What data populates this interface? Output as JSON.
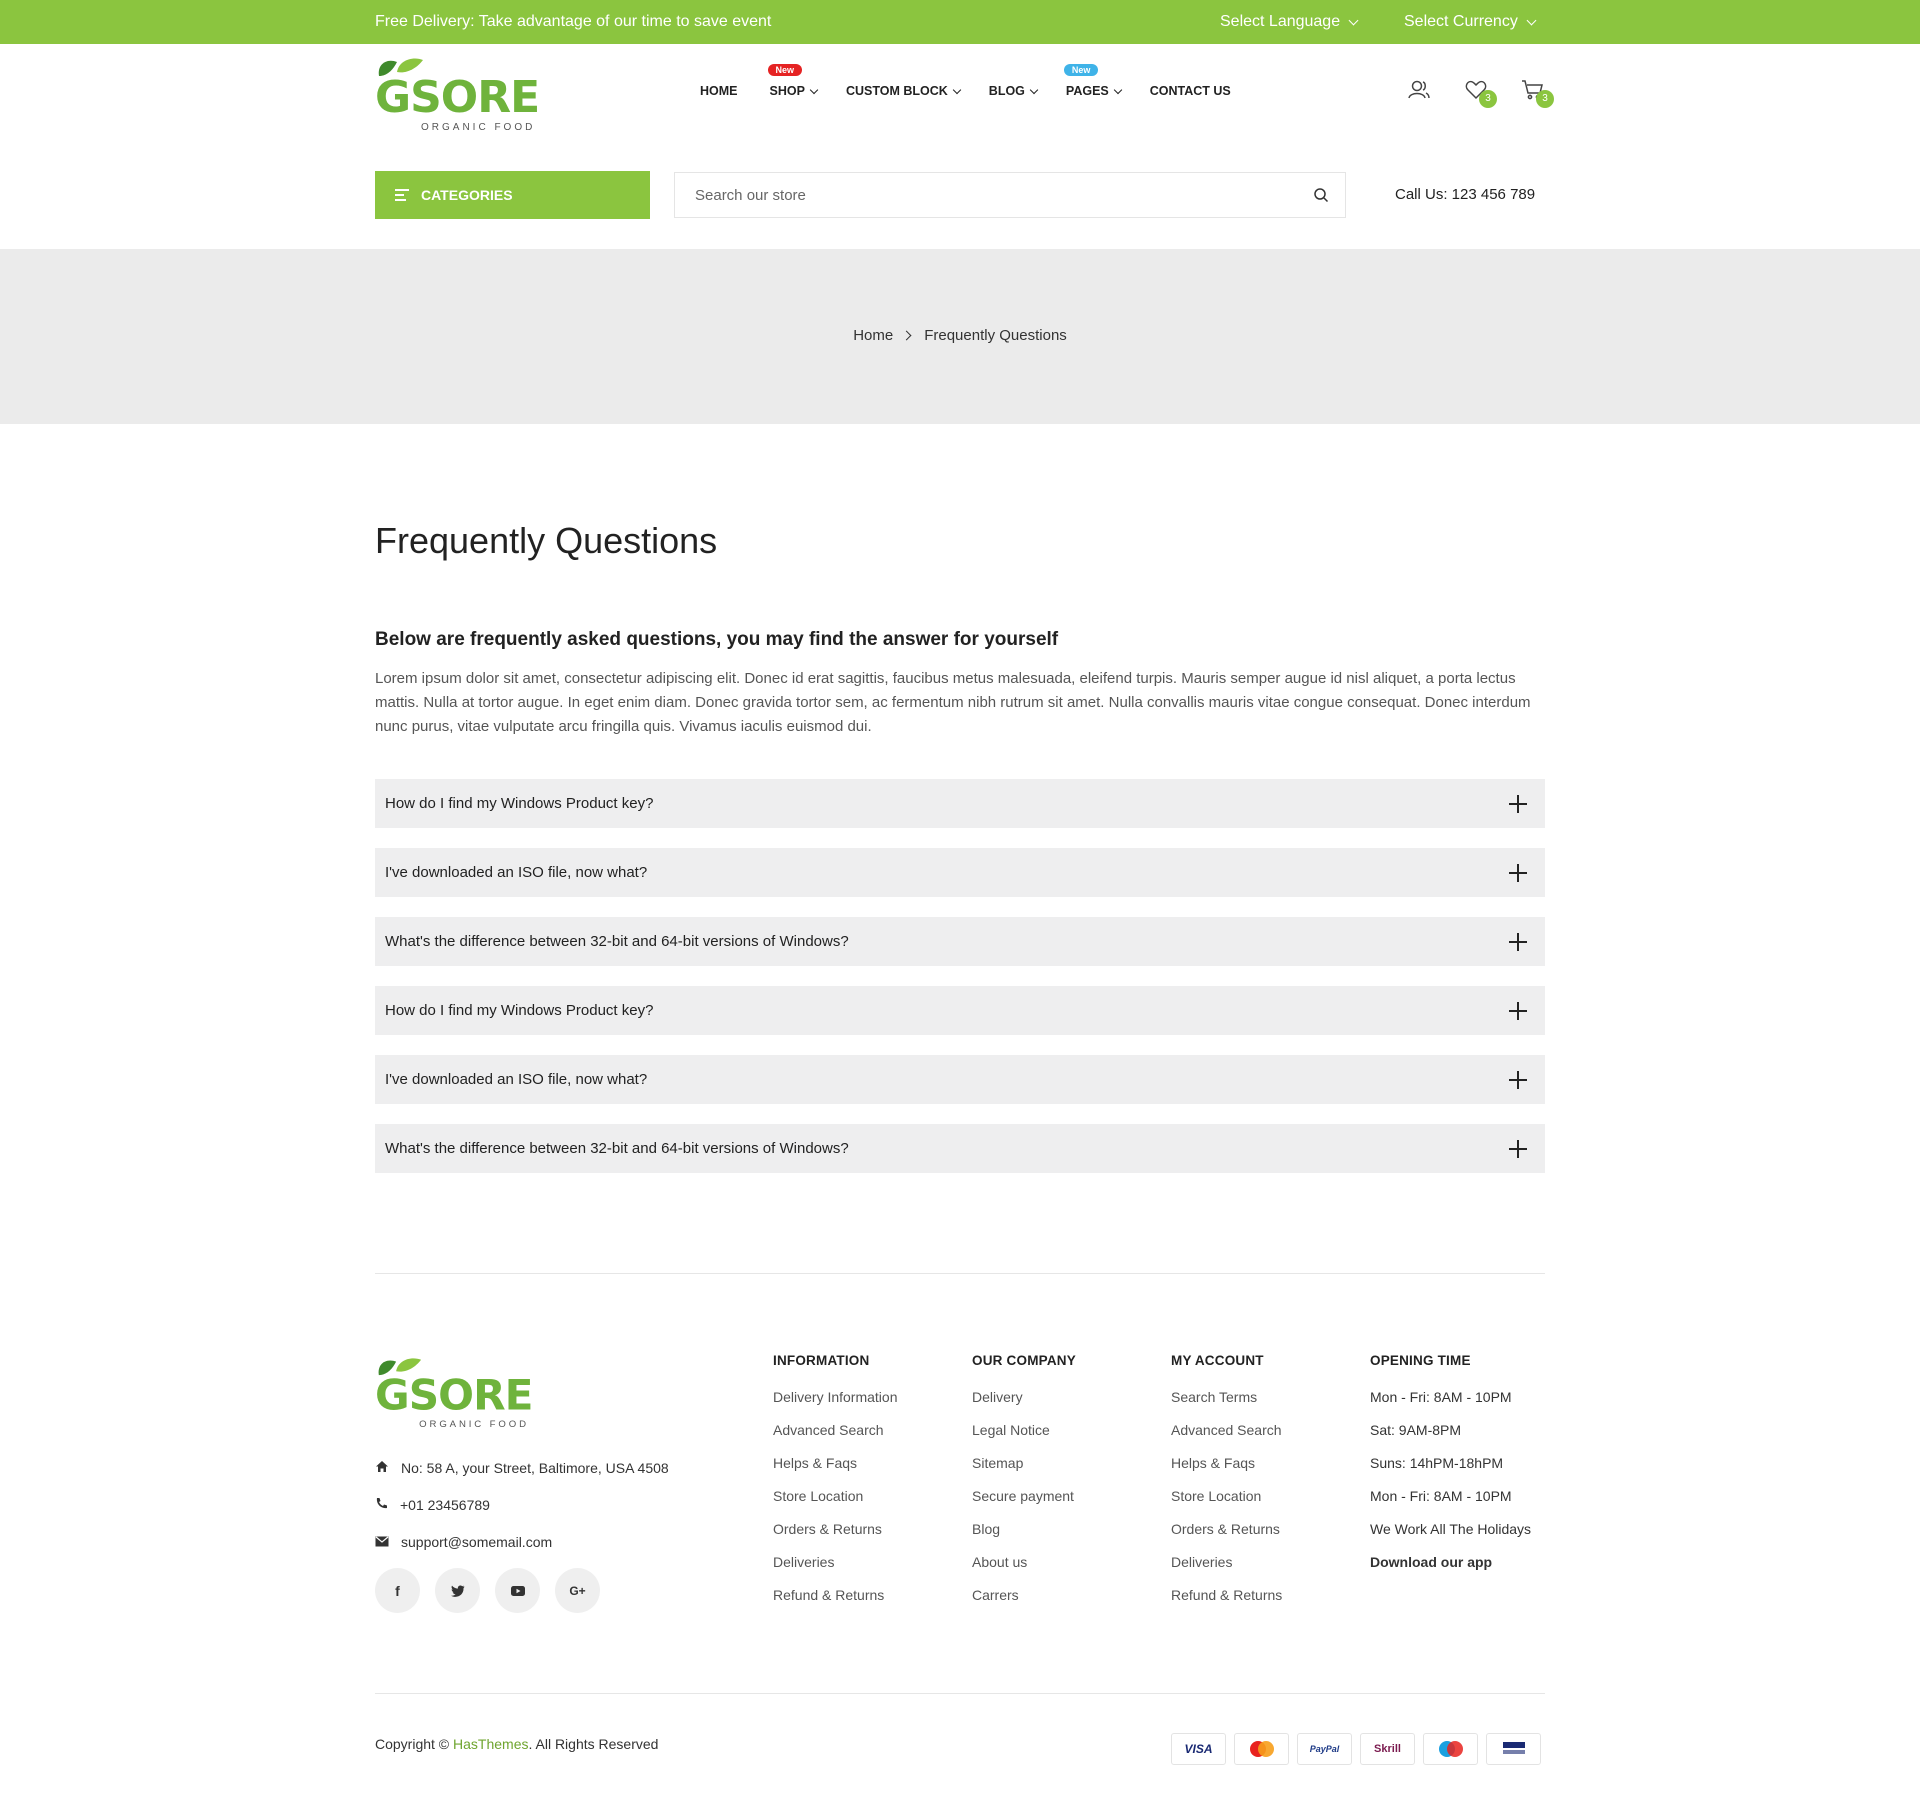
{
  "topbar": {
    "promo": "Free Delivery: Take advantage of our time to save event",
    "language": "Select Language",
    "currency": "Select Currency"
  },
  "logo": {
    "word": "GSORE",
    "tagline": "ORGANIC FOOD"
  },
  "nav": {
    "home": "HOME",
    "shop": "SHOP",
    "shop_badge": "New",
    "custom_block": "CUSTOM BLOCK",
    "blog": "BLOG",
    "pages": "PAGES",
    "pages_badge": "New",
    "contact": "CONTACT US"
  },
  "header": {
    "wishlist_count": "3",
    "cart_count": "3",
    "categories_label": "CATEGORIES",
    "search_placeholder": "Search our store",
    "call_us": "Call Us: 123 456 789"
  },
  "breadcrumb": {
    "home": "Home",
    "current": "Frequently Questions"
  },
  "faq": {
    "title": "Frequently Questions",
    "subtitle": "Below are frequently asked questions, you may find the answer for yourself",
    "description": "Lorem ipsum dolor sit amet, consectetur adipiscing elit. Donec id erat sagittis, faucibus metus malesuada, eleifend turpis. Mauris semper augue id nisl aliquet, a porta lectus mattis. Nulla at tortor augue. In eget enim diam. Donec gravida tortor sem, ac fermentum nibh rutrum sit amet. Nulla convallis mauris vitae congue consequat. Donec interdum nunc purus, vitae vulputate arcu fringilla quis. Vivamus iaculis euismod dui.",
    "questions": [
      "How do I find my Windows Product key?",
      "I've downloaded an ISO file, now what?",
      "What's the difference between 32-bit and 64-bit versions of Windows?",
      "How do I find my Windows Product key?",
      "I've downloaded an ISO file, now what?",
      "What's the difference between 32-bit and 64-bit versions of Windows?"
    ]
  },
  "footer": {
    "address": "No: 58 A, your Street, Baltimore, USA 4508",
    "phone": "+01 23456789",
    "email": "support@somemail.com",
    "social": {
      "facebook": "f",
      "google_plus": "G+"
    },
    "information": {
      "title": "INFORMATION",
      "items": [
        "Delivery Information",
        "Advanced Search",
        "Helps & Faqs",
        "Store Location",
        "Orders & Returns",
        "Deliveries",
        "Refund & Returns"
      ]
    },
    "company": {
      "title": "OUR COMPANY",
      "items": [
        "Delivery",
        "Legal Notice",
        "Sitemap",
        "Secure payment",
        "Blog",
        "About us",
        "Carrers"
      ]
    },
    "account": {
      "title": "MY ACCOUNT",
      "items": [
        "Search Terms",
        "Advanced Search",
        "Helps & Faqs",
        "Store Location",
        "Orders & Returns",
        "Deliveries",
        "Refund & Returns"
      ]
    },
    "opening": {
      "title": "OPENING TIME",
      "items": [
        "Mon - Fri: 8AM - 10PM",
        "Sat: 9AM-8PM",
        "Suns: 14hPM-18hPM",
        "Mon - Fri: 8AM - 10PM",
        "We Work All The Holidays"
      ],
      "download": "Download our app"
    },
    "copyright_prefix": "Copyright ©",
    "copyright_brand": "HasThemes",
    "copyright_suffix": ". All Rights Reserved",
    "payments": [
      "VISA",
      "PayPal",
      "Skrill"
    ]
  },
  "colors": {
    "accent": "#8bc53f",
    "badge_red": "#e52323",
    "badge_blue": "#3fb3e8",
    "band": "#ebebeb",
    "accordion": "#eeeeef"
  }
}
